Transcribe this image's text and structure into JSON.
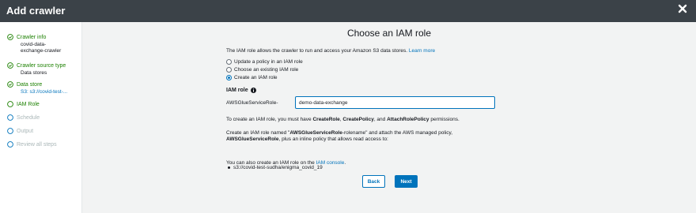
{
  "header": {
    "title": "Add crawler",
    "close_icon": "close-icon"
  },
  "sidebar": {
    "steps": [
      {
        "label": "Crawler info",
        "state": "done",
        "sub": [
          "covid-data-",
          "exchange-crawler"
        ]
      },
      {
        "label": "Crawler source type",
        "state": "done",
        "sub": [
          "Data stores"
        ]
      },
      {
        "label": "Data store",
        "state": "done",
        "sub": [
          "S3: s3://covid-test-..."
        ]
      },
      {
        "label": "IAM Role",
        "state": "current"
      },
      {
        "label": "Schedule",
        "state": "todo"
      },
      {
        "label": "Output",
        "state": "todo"
      },
      {
        "label": "Review all steps",
        "state": "todo"
      }
    ]
  },
  "main": {
    "heading": "Choose an IAM role",
    "intro": "The IAM role allows the crawler to run and access your Amazon S3 data stores.",
    "learn_more": "Learn more",
    "radios": [
      {
        "label": "Update a policy in an IAM role",
        "selected": false
      },
      {
        "label": "Choose an existing IAM role",
        "selected": false
      },
      {
        "label": "Create an IAM role",
        "selected": true
      }
    ],
    "iam_role_label": "IAM role",
    "role_prefix": "AWSGlueServiceRole-",
    "role_value": "demo-data-exchange",
    "perm": {
      "p1": "To create an IAM role, you must have ",
      "b1": "CreateRole",
      "p2": ", ",
      "b2": "CreatePolicy",
      "p3": ", and ",
      "b3": "AttachRolePolicy",
      "p4": " permissions."
    },
    "create": {
      "p1": "Create an IAM role named \"",
      "b1": "AWSGlueServiceRole",
      "p2": "-rolename\" and attach the AWS managed policy,",
      "b2": "AWSGlueServiceRole",
      "p3": ", plus an inline policy that allows read access to:"
    },
    "s3_path": "s3://covid-test-sudha/enigma_covid_19",
    "console": {
      "p1": "You can also create an IAM role on the ",
      "link": "IAM console",
      "p2": "."
    },
    "buttons": {
      "back": "Back",
      "next": "Next"
    }
  },
  "colors": {
    "header_bg": "#3b4248",
    "accent": "#0073bb",
    "success": "#1d8102",
    "disabled": "#aab7b8"
  }
}
